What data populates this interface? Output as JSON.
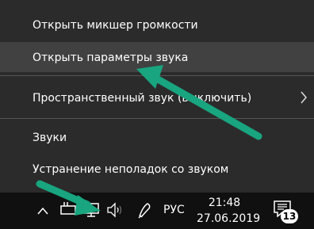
{
  "menu": {
    "items": [
      {
        "label": "Открыть микшер громкости"
      },
      {
        "label": "Открыть параметры звука"
      },
      {
        "label": "Пространственный звук (выключить)"
      },
      {
        "label": "Звуки"
      },
      {
        "label": "Устранение неполадок со звуком"
      }
    ],
    "submenu_arrow_glyph": "›"
  },
  "taskbar": {
    "overflow_chevron_glyph": "^",
    "language": "РУС",
    "time": "21:48",
    "date": "27.06.2019",
    "notification_count": "13",
    "icons": [
      "chevron-up-icon",
      "battery-plug-icon",
      "network-monitor-icon",
      "speaker-icon",
      "pen-icon",
      "notification-icon"
    ]
  },
  "colors": {
    "menu_bg": "#2b2b2b",
    "menu_hover": "#414141",
    "taskbar_bg": "#101010",
    "annotation_arrow": "#18a57f"
  }
}
